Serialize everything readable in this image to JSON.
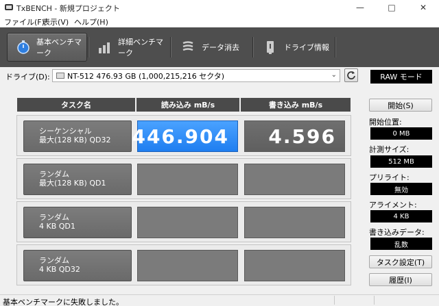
{
  "window": {
    "title": "TxBENCH - 新規プロジェクト",
    "minimize_icon": "minimize-icon",
    "maximize_icon": "maximize-icon",
    "close_icon": "close-icon"
  },
  "menu": {
    "file": "ファイル(F)",
    "view": "表示(V)",
    "help": "ヘルプ(H)"
  },
  "toolbar": {
    "basic": "基本ベンチマーク",
    "detail": "詳細ベンチマーク",
    "erase": "データ消去",
    "drive_info": "ドライブ情報"
  },
  "drive": {
    "label": "ドライブ(D):",
    "selected": "NT-512  476.93 GB (1,000,215,216 セクタ)"
  },
  "table": {
    "headers": [
      "タスク名",
      "読み込み mB/s",
      "書き込み mB/s"
    ],
    "rows": [
      {
        "line1": "シーケンシャル",
        "line2": "最大(128 KB) QD32",
        "read": "446.904",
        "write": "4.596"
      },
      {
        "line1": "ランダム",
        "line2": "最大(128 KB) QD1",
        "read": "",
        "write": ""
      },
      {
        "line1": "ランダム",
        "line2": "4 KB QD1",
        "read": "",
        "write": ""
      },
      {
        "line1": "ランダム",
        "line2": "4 KB QD32",
        "read": "",
        "write": ""
      }
    ]
  },
  "side": {
    "raw_mode": "RAW モード",
    "start": "開始(S)",
    "start_pos_label": "開始位置:",
    "start_pos": "0 MB",
    "size_label": "計測サイズ:",
    "size": "512 MB",
    "prewrite_label": "プリライト:",
    "prewrite": "無効",
    "alignment_label": "アライメント:",
    "alignment": "4 KB",
    "write_data_label": "書き込みデータ:",
    "write_data": "乱数",
    "task_settings": "タスク設定(T)",
    "history": "履歴(I)"
  },
  "status": {
    "message": "基本ベンチマークに失敗しました。"
  },
  "colors": {
    "toolbar_bg": "#4e4e4e",
    "highlight_blue": "#2b8cff",
    "cell_gray": "#7b7b7b"
  }
}
